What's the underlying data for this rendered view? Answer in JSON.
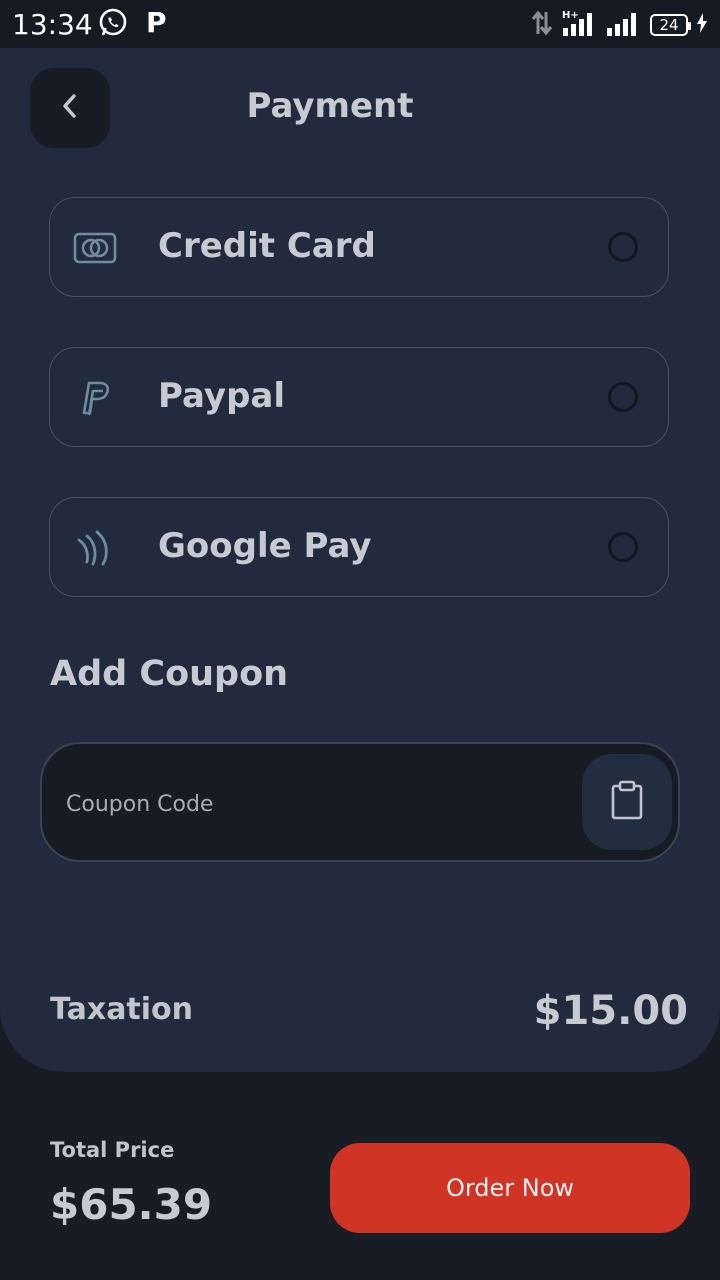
{
  "status_bar": {
    "time": "13:34",
    "battery": "24",
    "icons": [
      "whatsapp-icon",
      "p-icon",
      "data-arrows-icon",
      "signal-hplus-icon",
      "signal-icon",
      "battery-icon",
      "charging-icon"
    ]
  },
  "header": {
    "title": "Payment",
    "back_icon": "chevron-left-icon"
  },
  "payment_methods": [
    {
      "label": "Credit Card",
      "icon": "credit-card-icon",
      "selected": false
    },
    {
      "label": "Paypal",
      "icon": "paypal-icon",
      "selected": false
    },
    {
      "label": "Google Pay",
      "icon": "google-pay-icon",
      "selected": false
    }
  ],
  "coupon": {
    "title": "Add Coupon",
    "placeholder": "Coupon Code",
    "value": "",
    "paste_icon": "clipboard-icon"
  },
  "summary": {
    "taxation_label": "Taxation",
    "taxation_value": "$15.00",
    "total_label": "Total Price",
    "total_value": "$65.39"
  },
  "order_button": "Order Now",
  "colors": {
    "panel": "#212b3d",
    "background": "#181c25",
    "accent": "#cf3424",
    "icon": "#6f8da0"
  }
}
